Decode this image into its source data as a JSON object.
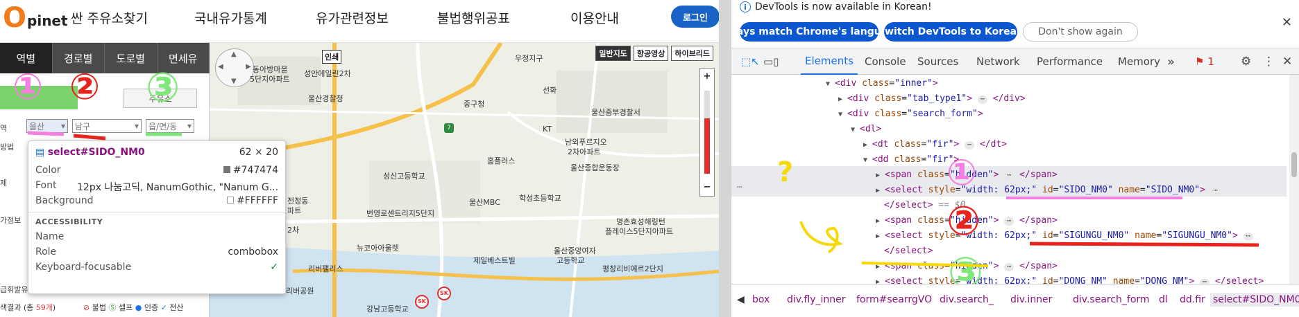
{
  "site": {
    "logo_letter": "O",
    "logo_rest": "pinet",
    "nav": [
      "싼 주유소찾기",
      "국내유가통계",
      "유가관련정보",
      "불법행위공표",
      "이용안내"
    ],
    "login": "로그인",
    "side_tabs": [
      "역별",
      "경로별",
      "도로별",
      "면세유"
    ],
    "gray_button": "주유소",
    "selects": {
      "sido": "울산",
      "sigungu": "남구",
      "dong": "읍/면/동"
    },
    "side_labels": [
      "역",
      "방법",
      "제",
      "가정보"
    ],
    "side_bottom_prefix": "급휘발유",
    "result_prefix": "색결과 (총 ",
    "result_count": "59개",
    "result_suffix": ")",
    "legend": [
      "불법",
      "셀프",
      "인증",
      "전산"
    ],
    "map_types": [
      "일반지도",
      "항공영상",
      "하이브리드"
    ],
    "map_print": "인쇄",
    "map_labels": [
      "동아방마을",
      "5단지아파트",
      "성안에일린2차",
      "우정지구",
      "울산경찰청",
      "중구청",
      "선화",
      "울산중부경찰서",
      "남외푸르지오",
      "2차아파트",
      "KT",
      "홈플러스",
      "성신고등학교",
      "울산종합운동장",
      "울산MBC",
      "학성초등학교",
      "번영로센트리지5단지",
      "명촌효성해링턴",
      "플레이스5단지아파트",
      "뉴코아아울렛",
      "울산중앙여자",
      "고등학교",
      "제일베스트빌",
      "리버팰리스",
      "평창리비에르2단지",
      "강남고등학교",
      "리버공원",
      "2차",
      "전정동",
      "파트"
    ]
  },
  "tooltip": {
    "selector": "select#SIDO_NM0",
    "size": "62 × 20",
    "color_label": "Color",
    "color_value": "#747474",
    "font_label": "Font",
    "font_value": "12px 나눔고딕, NanumGothic, \"Nanum G...",
    "bg_label": "Background",
    "bg_value": "#FFFFFF",
    "a11y_title": "ACCESSIBILITY",
    "name_label": "Name",
    "name_value": "",
    "role_label": "Role",
    "role_value": "combobox",
    "kbd_label": "Keyboard-focusable"
  },
  "annotations": {
    "one": "①",
    "two": "②",
    "three": "③",
    "question": "?",
    "colors": {
      "pink": "#f57ee0",
      "red": "#e8231d",
      "green": "#7ee87a",
      "yellow": "#f5d90a"
    }
  },
  "devtools": {
    "info": "DevTools is now available in Korean!",
    "btn_match": "Always match Chrome's language",
    "btn_switch": "Switch DevTools to Korean",
    "btn_dismiss": "Don't show again",
    "tabs": [
      "Elements",
      "Console",
      "Sources",
      "Network",
      "Performance",
      "Memory"
    ],
    "more_tabs": "»",
    "issues_count": "1",
    "tree": {
      "l1_tag": "div",
      "l1_attr": "class",
      "l1_val": "inner",
      "l2_val": "tab_type1",
      "l3_val": "search_form",
      "l4_tag": "dl",
      "l5_tag": "dt",
      "l5_val": "fir",
      "l6_tag": "dd",
      "l6_val": "fir",
      "span_tag": "span",
      "span_val": "hid",
      "sel_tag": "select",
      "style_attr": "style",
      "style_val_1": "width: 62px;",
      "style_val_2": "width: 62px;",
      "style_val_3": "width: 62px;",
      "id_1": "SIDO_NM0",
      "id_2": "SIGUNGU_NM0",
      "id_3": "DONG_NM",
      "eq0": "== $0"
    },
    "breadcrumbs": [
      "box",
      "div.fly_inner",
      "form#searrgVO",
      "div.search_",
      "div.inner",
      "div.search_form",
      "dl",
      "dd.fir",
      "select#SIDO_NM0"
    ]
  }
}
